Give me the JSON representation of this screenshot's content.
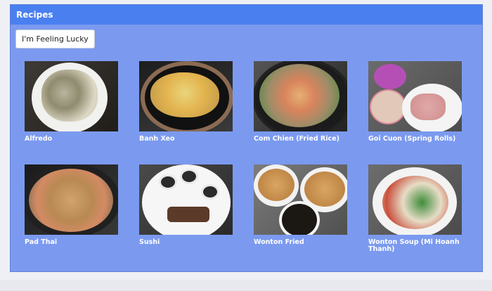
{
  "panel": {
    "title": "Recipes"
  },
  "actions": {
    "lucky_label": "I'm Feeling Lucky"
  },
  "recipes": [
    {
      "name": "Alfredo",
      "image": "alfredo-photo"
    },
    {
      "name": "Banh Xeo",
      "image": "banh-xeo-photo"
    },
    {
      "name": "Com Chien (Fried Rice)",
      "image": "com-chien-photo"
    },
    {
      "name": "Goi Cuon (Spring Rolls)",
      "image": "goi-cuon-photo"
    },
    {
      "name": "Pad Thai",
      "image": "pad-thai-photo"
    },
    {
      "name": "Sushi",
      "image": "sushi-photo"
    },
    {
      "name": "Wonton Fried",
      "image": "wonton-fried-photo"
    },
    {
      "name": "Wonton Soup (Mi Hoanh Thanh)",
      "image": "wonton-soup-photo"
    }
  ],
  "colors": {
    "panel_bg": "#7b9aef",
    "header_bg": "#4a7ff0",
    "caption_text": "#ffffff"
  }
}
